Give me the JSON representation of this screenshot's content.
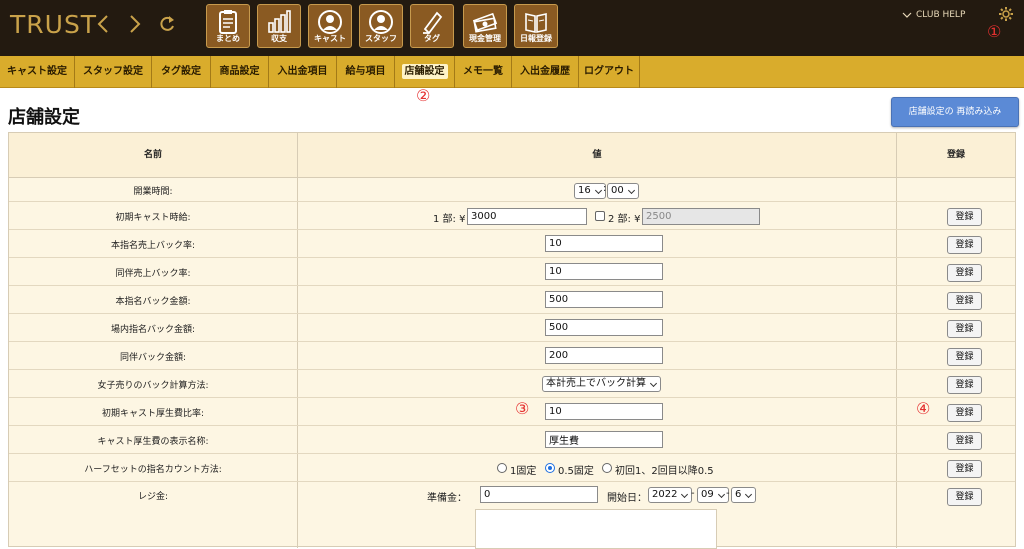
{
  "app": {
    "logo": "TRUST",
    "toolbar": [
      {
        "icon": "clipboard-icon",
        "label": "まとめ"
      },
      {
        "icon": "bar-chart-icon",
        "label": "収支"
      },
      {
        "icon": "person-icon",
        "label": "キャスト"
      },
      {
        "icon": "person-icon",
        "label": "スタッフ"
      },
      {
        "icon": "pen-icon",
        "label": "タグ"
      },
      {
        "icon": "money-icon",
        "label": "現金管理"
      },
      {
        "icon": "book-icon",
        "label": "日報登録"
      }
    ],
    "club_help": "CLUB HELP",
    "settings_icon": "gear-icon"
  },
  "annotations": {
    "a1": "①",
    "a2": "②",
    "a3": "③",
    "a4": "④"
  },
  "tabs": [
    {
      "label": "キャスト設定"
    },
    {
      "label": "スタッフ設定"
    },
    {
      "label": "タグ設定"
    },
    {
      "label": "商品設定"
    },
    {
      "label": "入出金項目"
    },
    {
      "label": "給与項目"
    },
    {
      "label": "店舗設定",
      "active": true
    },
    {
      "label": "メモ一覧"
    },
    {
      "label": "入出金履歴"
    },
    {
      "label": "ログアウト"
    }
  ],
  "page": {
    "title": "店舗設定",
    "reload_button": "店舗設定の 再読み込み"
  },
  "table": {
    "headers": {
      "name": "名前",
      "value": "値",
      "register": "登録"
    },
    "register_label": "登録",
    "rows": {
      "opening_time": {
        "label": "開業時間:",
        "hour": "16",
        "minute": "00"
      },
      "initial_cast_wage": {
        "label": "初期キャスト時給:",
        "part1_label": "1 部: ¥",
        "part1_value": "3000",
        "part2_label": "2 部: ¥",
        "part2_value": "2500"
      },
      "designation_sales_back_rate": {
        "label": "本指名売上バック率:",
        "value": "10"
      },
      "accompany_sales_back_rate": {
        "label": "同伴売上バック率:",
        "value": "10"
      },
      "designation_back_amount": {
        "label": "本指名バック金額:",
        "value": "500"
      },
      "in_store_designation_back_amount": {
        "label": "場内指名バック金額:",
        "value": "500"
      },
      "accompany_back_amount": {
        "label": "同伴バック金額:",
        "value": "200"
      },
      "girl_sales_back_method": {
        "label": "女子売りのバック計算方法:",
        "value": "本計売上でバック計算"
      },
      "initial_cast_welfare_rate": {
        "label": "初期キャスト厚生費比率:",
        "value": "10"
      },
      "cast_welfare_display_name": {
        "label": "キャスト厚生費の表示名称:",
        "value": "厚生費"
      },
      "halfset_designation_count": {
        "label": "ハーフセットの指名カウント方法:",
        "options": [
          "1固定",
          "0.5固定",
          "初回1、2回目以降0.5"
        ],
        "selected": 1
      },
      "register_cash": {
        "label": "レジ金:",
        "reserve_label": "準備金：",
        "reserve_value": "0",
        "start_label": "開始日：",
        "year": "2022",
        "month": "09",
        "day": "6"
      }
    }
  }
}
